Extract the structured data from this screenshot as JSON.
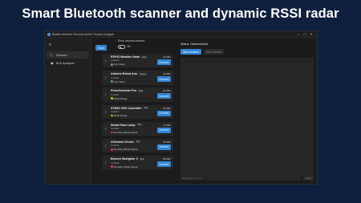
{
  "headline": "Smart Bluetooth scanner and dynamic RSSI radar",
  "window": {
    "title": "BlueBlu Bluetooth Terminal and BLE Scanner Analyzer",
    "minimize": "—",
    "maximize": "☐",
    "close": "✕"
  },
  "sidebar": {
    "menu_icon": "≡",
    "items": [
      {
        "label": "Devices",
        "icon": "bluetooth-icon",
        "glyph": "ᛒ",
        "active": true
      },
      {
        "label": "BLE Analyzer",
        "icon": "radar-icon",
        "glyph": "◉",
        "active": false
      }
    ]
  },
  "scanner": {
    "scan_label": "Scan",
    "unknown_label": "Show unknown devices",
    "toggle_state": "Off",
    "devices": [
      {
        "name": "ESP32 Weather Node",
        "badge": "BLE",
        "sub": "Available",
        "distance": "Very Close",
        "dot": "#4caf50",
        "rssi": "-45 dBm",
        "connect": "Connect"
      },
      {
        "name": "Arduino Robot Arm",
        "badge": "Classic",
        "sub": "Available",
        "distance": "Very Close",
        "dot": "#4caf50",
        "rssi": "-48 dBm",
        "connect": "Connect"
      },
      {
        "name": "PulseOximeter Pro",
        "badge": "BLE",
        "sub": "Available",
        "distance": "Within Range",
        "dot": "#e6b800",
        "rssi": "-62 dBm",
        "connect": "Connect"
      },
      {
        "name": "STM32 CNC Controller",
        "badge": "BLE",
        "sub": "Available",
        "distance": "Within Range",
        "dot": "#e6b800",
        "rssi": "-66 dBm",
        "connect": "Connect"
      },
      {
        "name": "Smart Glow Lamp",
        "badge": "BLE",
        "sub": "Available",
        "distance": "Far Away (Weak Signal)",
        "dot": "#e53935",
        "rssi": "-79 dBm",
        "connect": "Connect"
      },
      {
        "name": "Unknown Device",
        "badge": "BLE",
        "sub": "Available",
        "distance": "Far Away (Weak Signal)",
        "dot": "#e53935",
        "rssi": "-83 dBm",
        "connect": "Connect"
      },
      {
        "name": "Beacon Navigator X",
        "badge": "BLE",
        "sub": "Available",
        "distance": "Far Away (Weak Signal)",
        "dot": "#e53935",
        "rssi": "-88 dBm",
        "connect": "Connect"
      }
    ]
  },
  "terminal": {
    "status": "Status: Disconnected",
    "start_label": "Start Terminal",
    "stop_label": "Stop Terminal",
    "input_placeholder": "Enter text to send...",
    "send_label": "Send"
  },
  "colors": {
    "background": "#0f1f3e",
    "accent": "#2f86d8",
    "window": "#1b1b1b"
  }
}
